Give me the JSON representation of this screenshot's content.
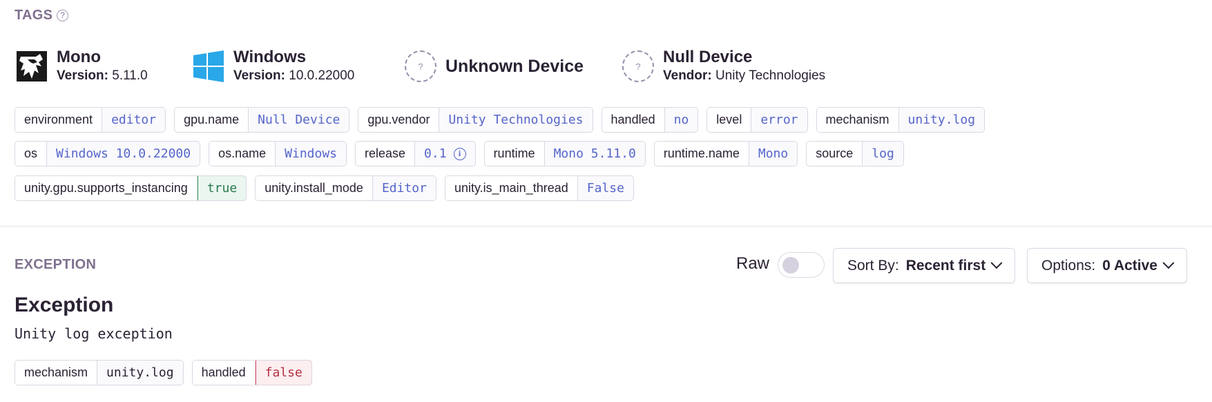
{
  "tags_section": {
    "title": "TAGS",
    "help_icon": "question-circle-icon",
    "contexts": [
      {
        "name": "Mono",
        "sub_label": "Version:",
        "sub_value": "5.11.0",
        "icon": "mono-logo-icon"
      },
      {
        "name": "Windows",
        "sub_label": "Version:",
        "sub_value": "10.0.22000",
        "icon": "windows-logo-icon"
      },
      {
        "name": "Unknown Device",
        "icon": "unknown-device-icon",
        "icon_text": "?"
      },
      {
        "name": "Null Device",
        "sub_label": "Vendor:",
        "sub_value": "Unity Technologies",
        "icon": "unknown-device-icon",
        "icon_text": "?"
      }
    ],
    "tags": [
      {
        "key": "environment",
        "value": "editor"
      },
      {
        "key": "gpu.name",
        "value": "Null Device"
      },
      {
        "key": "gpu.vendor",
        "value": "Unity Technologies"
      },
      {
        "key": "handled",
        "value": "no"
      },
      {
        "key": "level",
        "value": "error"
      },
      {
        "key": "mechanism",
        "value": "unity.log"
      },
      {
        "key": "os",
        "value": "Windows 10.0.22000"
      },
      {
        "key": "os.name",
        "value": "Windows"
      },
      {
        "key": "release",
        "value": "0.1",
        "info_icon": "info-circle-icon"
      },
      {
        "key": "runtime",
        "value": "Mono 5.11.0"
      },
      {
        "key": "runtime.name",
        "value": "Mono"
      },
      {
        "key": "source",
        "value": "log"
      },
      {
        "key": "unity.gpu.supports_instancing",
        "value": "true"
      },
      {
        "key": "unity.install_mode",
        "value": "Editor"
      },
      {
        "key": "unity.is_main_thread",
        "value": "False"
      }
    ]
  },
  "exception_section": {
    "title": "EXCEPTION",
    "raw_label": "Raw",
    "raw_enabled": false,
    "sort": {
      "label": "Sort By:",
      "value": "Recent first"
    },
    "options": {
      "label": "Options:",
      "value": "0 Active"
    },
    "exception_type": "Exception",
    "exception_value": "Unity log exception",
    "mechanism": [
      {
        "key": "mechanism",
        "value": "unity.log"
      },
      {
        "key": "handled",
        "value": "false"
      }
    ]
  },
  "colors": {
    "accent_value": "#5566c9",
    "section_title": "#80708f",
    "true_green": "#2b7a4f",
    "false_red": "#b3303f"
  }
}
